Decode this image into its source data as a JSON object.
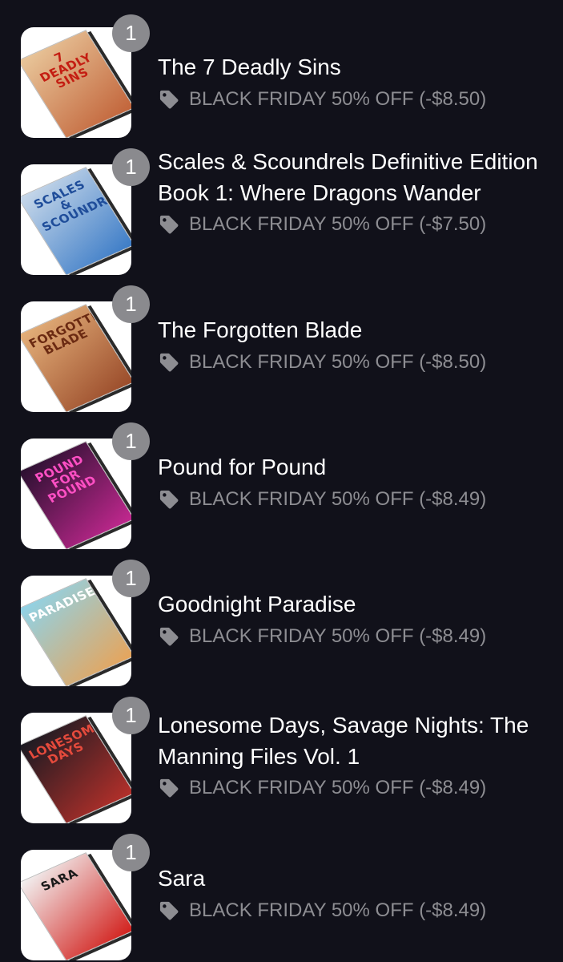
{
  "cart": {
    "items": [
      {
        "quantity": "1",
        "title": "The 7 Deadly Sins",
        "discount": "BLACK FRIDAY 50% OFF (-$8.50)",
        "cover": {
          "colors": [
            "#e9c79b",
            "#c2643a"
          ],
          "text": "7 DEADLY SINS",
          "text_color": "#c41d12"
        }
      },
      {
        "quantity": "1",
        "title": "Scales & Scoundrels Definitive Edition Book 1: Where Dragons Wander",
        "discount": "BLACK FRIDAY 50% OFF (-$7.50)",
        "cover": {
          "colors": [
            "#c9d9ea",
            "#3c7cc7"
          ],
          "text": "SCALES & SCOUNDRELS",
          "text_color": "#1f4d9a"
        }
      },
      {
        "quantity": "1",
        "title": "The Forgotten Blade",
        "discount": "BLACK FRIDAY 50% OFF (-$8.50)",
        "cover": {
          "colors": [
            "#e4b07a",
            "#9a4b2a"
          ],
          "text": "FORGOTTEN BLADE",
          "text_color": "#6b2a12"
        }
      },
      {
        "quantity": "1",
        "title": "Pound for Pound",
        "discount": "BLACK FRIDAY 50% OFF (-$8.49)",
        "cover": {
          "colors": [
            "#2a1030",
            "#c2288f"
          ],
          "text": "POUND FOR POUND",
          "text_color": "#ff4fc4"
        }
      },
      {
        "quantity": "1",
        "title": "Goodnight Paradise",
        "discount": "BLACK FRIDAY 50% OFF (-$8.49)",
        "cover": {
          "colors": [
            "#8fd3e8",
            "#e7a45a"
          ],
          "text": "PARADISE",
          "text_color": "#ffffff"
        }
      },
      {
        "quantity": "1",
        "title": "Lonesome Days, Savage Nights: The Manning Files Vol. 1",
        "discount": "BLACK FRIDAY 50% OFF (-$8.49)",
        "cover": {
          "colors": [
            "#1a1a22",
            "#b5302a"
          ],
          "text": "LONESOME DAYS",
          "text_color": "#e54a3c"
        }
      },
      {
        "quantity": "1",
        "title": "Sara",
        "discount": "BLACK FRIDAY 50% OFF (-$8.49)",
        "cover": {
          "colors": [
            "#f2f2f2",
            "#d2201c"
          ],
          "text": "SARA",
          "text_color": "#1a1a1a"
        }
      }
    ]
  },
  "icons": {
    "tag_icon": "price-tag",
    "tag_color": "#8d8d92"
  }
}
